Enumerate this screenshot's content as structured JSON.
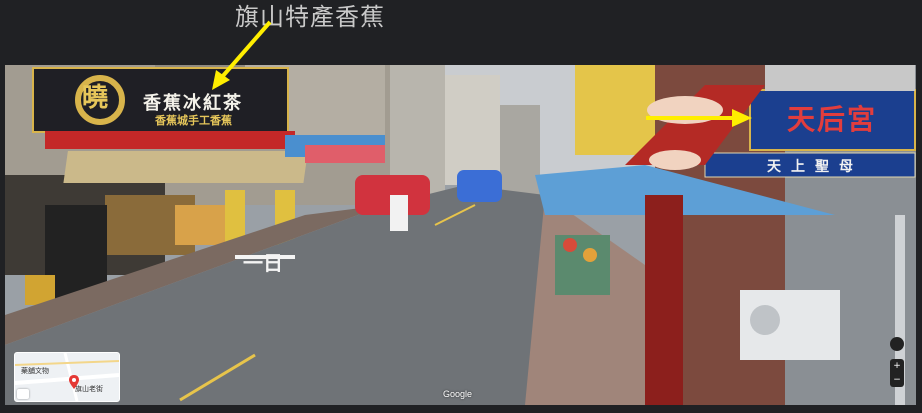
{
  "annotation": {
    "caption": "旗山特產香蕉"
  },
  "streetview": {
    "sign_banana_shop": "香蕉冰紅茶",
    "sign_banana_sub": "香蕉城手工香蕉",
    "sign_banana_logo": "曉",
    "sign_temple_main": "天后宮",
    "sign_temple_sub": "天上聖母",
    "road_marking": "一日",
    "attribution": "Google"
  },
  "minimap": {
    "label_1": "旗山老街",
    "label_2": "藥舖文物"
  },
  "controls": {
    "zoom_in": "+",
    "zoom_out": "−"
  },
  "colors": {
    "arrow": "#ffee00",
    "sky": "#c9ccd0",
    "road": "#6f7377",
    "sign_dark": "#1f1f25",
    "temple_blue": "#1b3f8f",
    "temple_red": "#b42a25",
    "awning_blue": "#5d9fd6"
  },
  "icons": {
    "arrow_left": "arrow-to-banana-sign-icon",
    "arrow_right": "arrow-to-temple-sign-icon",
    "map_pin": "map-pin-icon",
    "expand": "expand-icon",
    "compass": "compass-icon"
  }
}
